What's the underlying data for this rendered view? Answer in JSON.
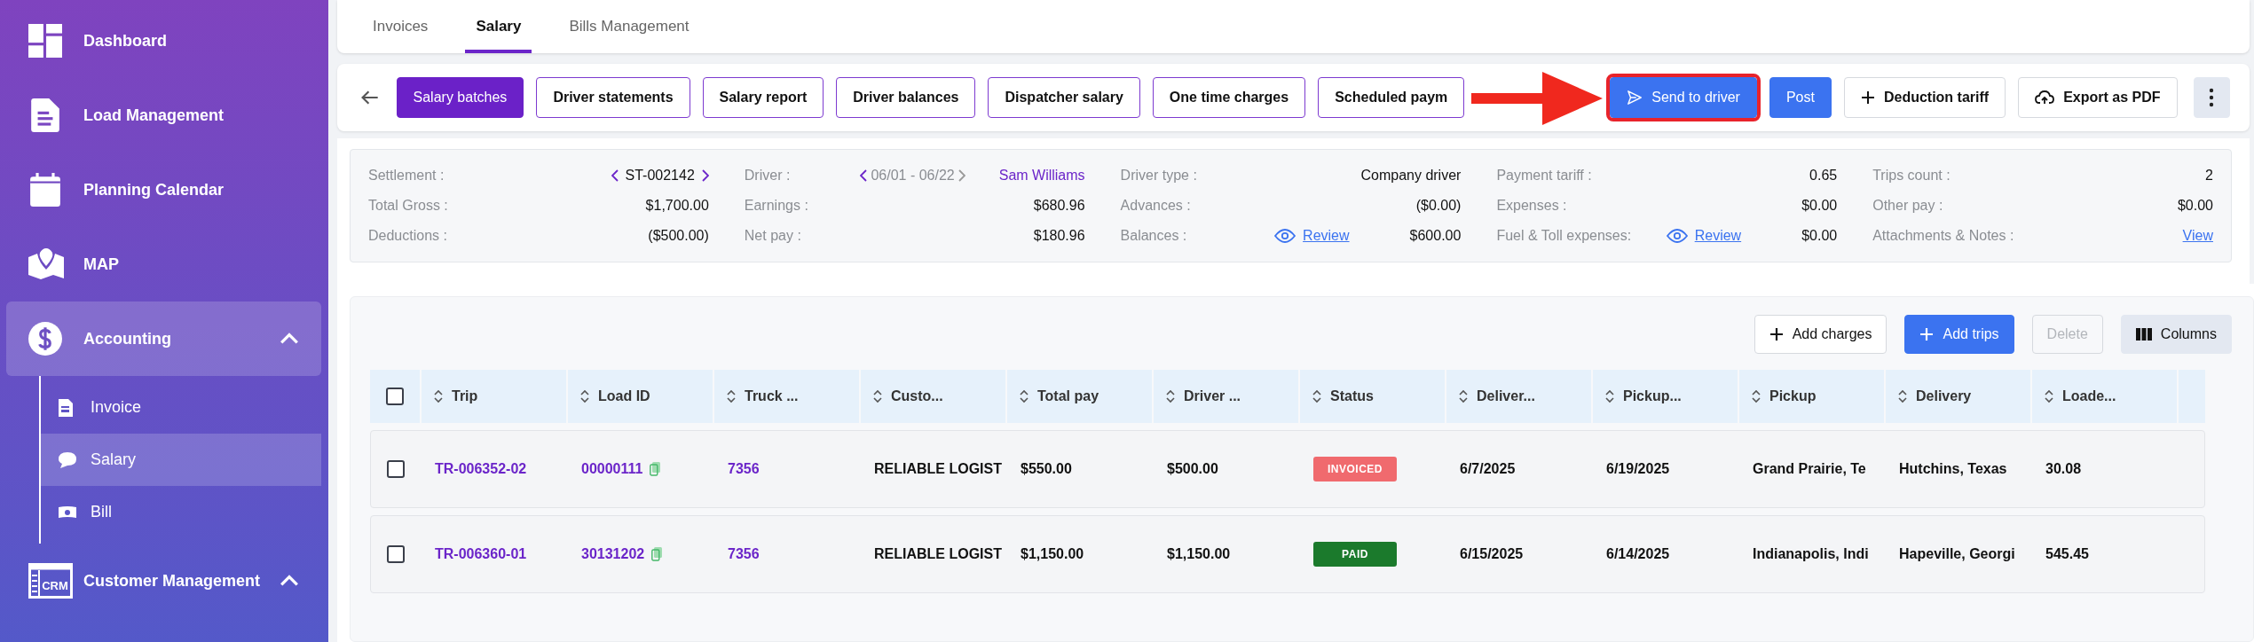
{
  "sidebar": {
    "items": [
      {
        "label": "Dashboard",
        "selected": false
      },
      {
        "label": "Load Management",
        "selected": false
      },
      {
        "label": "Planning Calendar",
        "selected": false
      },
      {
        "label": "MAP",
        "selected": false
      },
      {
        "label": "Accounting",
        "selected": true,
        "expanded": true,
        "children": [
          {
            "label": "Invoice",
            "selected": false
          },
          {
            "label": "Salary",
            "selected": true
          },
          {
            "label": "Bill",
            "selected": false
          }
        ]
      },
      {
        "label": "Customer Management",
        "selected": false,
        "expanded": true,
        "icon_text": "CRM"
      }
    ]
  },
  "tabs": [
    {
      "label": "Invoices",
      "selected": false
    },
    {
      "label": "Salary",
      "selected": true
    },
    {
      "label": "Bills Management",
      "selected": false
    }
  ],
  "toolbar": {
    "buttons": [
      {
        "label": "Salary batches",
        "kind": "filled"
      },
      {
        "label": "Driver statements",
        "kind": "outline"
      },
      {
        "label": "Salary report",
        "kind": "outline"
      },
      {
        "label": "Driver balances",
        "kind": "outline"
      },
      {
        "label": "Dispatcher salary",
        "kind": "outline"
      },
      {
        "label": "One time charges",
        "kind": "outline"
      },
      {
        "label": "Scheduled paym",
        "kind": "outline"
      },
      {
        "label": "Send to driver",
        "kind": "send",
        "highlighted": true
      },
      {
        "label": "Post",
        "kind": "blue"
      },
      {
        "label": "Deduction tariff",
        "kind": "add"
      },
      {
        "label": "Export as PDF",
        "kind": "export"
      },
      {
        "kind": "more"
      }
    ]
  },
  "summary": {
    "columns": [
      [
        {
          "label": "Settlement :",
          "value": "ST-002142",
          "kind": "stepper"
        },
        {
          "label": "Total Gross :",
          "value": "$1,700.00"
        },
        {
          "label": "Deductions :",
          "value": "($500.00)"
        }
      ],
      [
        {
          "label": "Driver :",
          "period": "06/01 - 06/22",
          "value": "Sam Williams",
          "kind": "driver"
        },
        {
          "label": "Earnings :",
          "value": "$680.96"
        },
        {
          "label": "Net pay :",
          "value": "$180.96"
        }
      ],
      [
        {
          "label": "Driver type :",
          "value": "Company driver"
        },
        {
          "label": "Advances :",
          "value": "($0.00)"
        },
        {
          "label": "Balances :",
          "link": "Review",
          "value": "$600.00",
          "kind": "review"
        }
      ],
      [
        {
          "label": "Payment tariff :",
          "value": "0.65"
        },
        {
          "label": "Expenses :",
          "value": "$0.00"
        },
        {
          "label": "Fuel & Toll expenses:",
          "link": "Review",
          "value": "$0.00",
          "kind": "review"
        }
      ],
      [
        {
          "label": "Trips count :",
          "value": "2"
        },
        {
          "label": "Other pay :",
          "value": "$0.00"
        },
        {
          "label": "Attachments & Notes :",
          "link": "View",
          "kind": "link"
        }
      ]
    ]
  },
  "table": {
    "actions": [
      {
        "label": "Add charges",
        "kind": "add",
        "disabled": false
      },
      {
        "label": "Add trips",
        "kind": "blue",
        "disabled": false
      },
      {
        "label": "Delete",
        "kind": "plain",
        "disabled": true
      },
      {
        "label": "Columns",
        "kind": "columns",
        "disabled": false
      }
    ],
    "header_checked": false,
    "columns": [
      {
        "label": "Trip",
        "kind": "link"
      },
      {
        "label": "Load ID",
        "kind": "copy"
      },
      {
        "label": "Truck ...",
        "kind": "link"
      },
      {
        "label": "Custo...",
        "kind": "text"
      },
      {
        "label": "Total pay",
        "kind": "text"
      },
      {
        "label": "Driver ...",
        "kind": "text"
      },
      {
        "label": "Status",
        "kind": "status"
      },
      {
        "label": "Deliver...",
        "kind": "text"
      },
      {
        "label": "Pickup...",
        "kind": "text"
      },
      {
        "label": "Pickup",
        "kind": "text"
      },
      {
        "label": "Delivery",
        "kind": "text"
      },
      {
        "label": "Loade...",
        "kind": "text"
      }
    ],
    "rows": [
      {
        "checked": false,
        "cells": [
          "TR-006352-02",
          "00000111",
          "7356",
          "RELIABLE LOGIST",
          "$550.00",
          "$500.00",
          {
            "label": "INVOICED",
            "color": "#f06a6e"
          },
          "6/7/2025",
          "6/19/2025",
          "Grand Prairie, Te",
          "Hutchins, Texas",
          "30.08"
        ]
      },
      {
        "checked": false,
        "cells": [
          "TR-006360-01",
          "30131202",
          "7356",
          "RELIABLE LOGIST",
          "$1,150.00",
          "$1,150.00",
          {
            "label": "PAID",
            "color": "#1b7a2c"
          },
          "6/15/2025",
          "6/14/2025",
          "Indianapolis, Indi",
          "Hapeville, Georgi",
          "545.45"
        ]
      }
    ]
  }
}
